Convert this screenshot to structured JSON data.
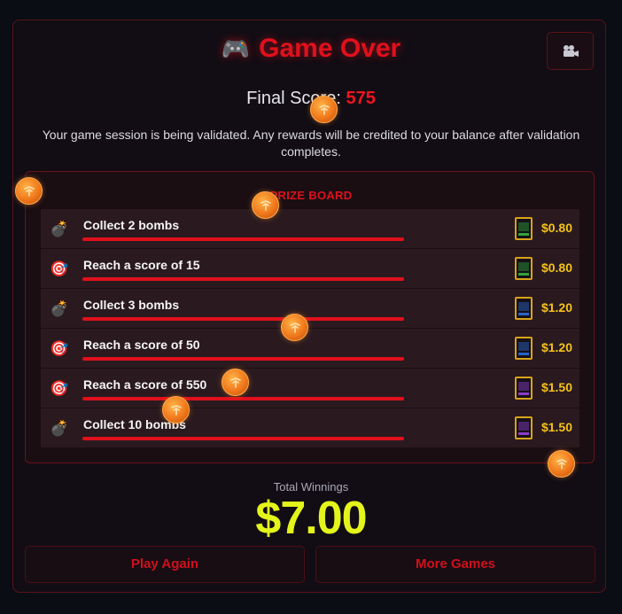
{
  "header": {
    "title": "Game Over",
    "title_icon": "gamepad-icon",
    "camera_icon": "film-camera-icon"
  },
  "final_score": {
    "label": "Final Score:",
    "value": "575"
  },
  "notice": "Your game session is being validated. Any rewards will be credited to your balance after validation completes.",
  "board": {
    "title": "PRIZE BOARD",
    "rows": [
      {
        "icon": "bomb-icon",
        "glyph": "💣",
        "label": "Collect 2 bombs",
        "prize": "$0.80",
        "machine_color": "#2fa33a"
      },
      {
        "icon": "target-icon",
        "glyph": "🎯",
        "label": "Reach a score of 15",
        "prize": "$0.80",
        "machine_color": "#2fa33a"
      },
      {
        "icon": "bomb-icon",
        "glyph": "💣",
        "label": "Collect 3 bombs",
        "prize": "$1.20",
        "machine_color": "#2a63c9"
      },
      {
        "icon": "target-icon",
        "glyph": "🎯",
        "label": "Reach a score of 50",
        "prize": "$1.20",
        "machine_color": "#2a63c9"
      },
      {
        "icon": "target-icon",
        "glyph": "🎯",
        "label": "Reach a score of 550",
        "prize": "$1.50",
        "machine_color": "#8b3cc9"
      },
      {
        "icon": "bomb-icon",
        "glyph": "💣",
        "label": "Collect 10 bombs",
        "prize": "$1.50",
        "machine_color": "#8b3cc9"
      }
    ]
  },
  "totals": {
    "label": "Total Winnings",
    "value": "$7.00"
  },
  "buttons": {
    "play_again": "Play Again",
    "more_games": "More Games"
  },
  "colors": {
    "accent_red": "#e0101c",
    "prize_gold": "#f4c21a",
    "total_yellow": "#e3f51a",
    "coin_orange": "#f0791c"
  }
}
